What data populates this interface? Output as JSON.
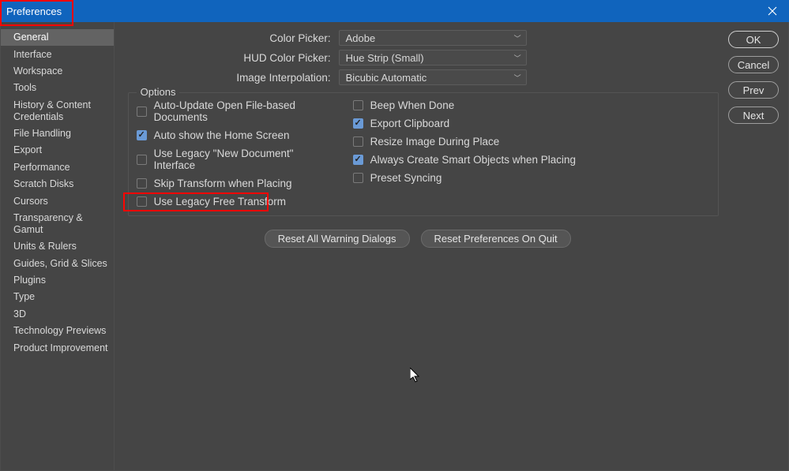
{
  "window": {
    "title": "Preferences"
  },
  "sidebar": {
    "items": [
      "General",
      "Interface",
      "Workspace",
      "Tools",
      "History & Content Credentials",
      "File Handling",
      "Export",
      "Performance",
      "Scratch Disks",
      "Cursors",
      "Transparency & Gamut",
      "Units & Rulers",
      "Guides, Grid & Slices",
      "Plugins",
      "Type",
      "3D",
      "Technology Previews",
      "Product Improvement"
    ],
    "active_index": 0
  },
  "dropdowns": {
    "color_picker": {
      "label": "Color Picker:",
      "value": "Adobe"
    },
    "hud_color_picker": {
      "label": "HUD Color Picker:",
      "value": "Hue Strip (Small)"
    },
    "image_interpolation": {
      "label": "Image Interpolation:",
      "value": "Bicubic Automatic"
    }
  },
  "options": {
    "title": "Options",
    "left": [
      {
        "label": "Auto-Update Open File-based Documents",
        "checked": false
      },
      {
        "label": "Auto show the Home Screen",
        "checked": true
      },
      {
        "label": "Use Legacy \"New Document\" Interface",
        "checked": false
      },
      {
        "label": "Skip Transform when Placing",
        "checked": false
      },
      {
        "label": "Use Legacy Free Transform",
        "checked": false
      }
    ],
    "right": [
      {
        "label": "Beep When Done",
        "checked": false
      },
      {
        "label": "Export Clipboard",
        "checked": true
      },
      {
        "label": "Resize Image During Place",
        "checked": false
      },
      {
        "label": "Always Create Smart Objects when Placing",
        "checked": true
      },
      {
        "label": "Preset Syncing",
        "checked": false
      }
    ]
  },
  "action_buttons": {
    "reset_warnings": "Reset All Warning Dialogs",
    "reset_prefs": "Reset Preferences On Quit"
  },
  "right_buttons": {
    "ok": "OK",
    "cancel": "Cancel",
    "prev": "Prev",
    "next": "Next"
  }
}
